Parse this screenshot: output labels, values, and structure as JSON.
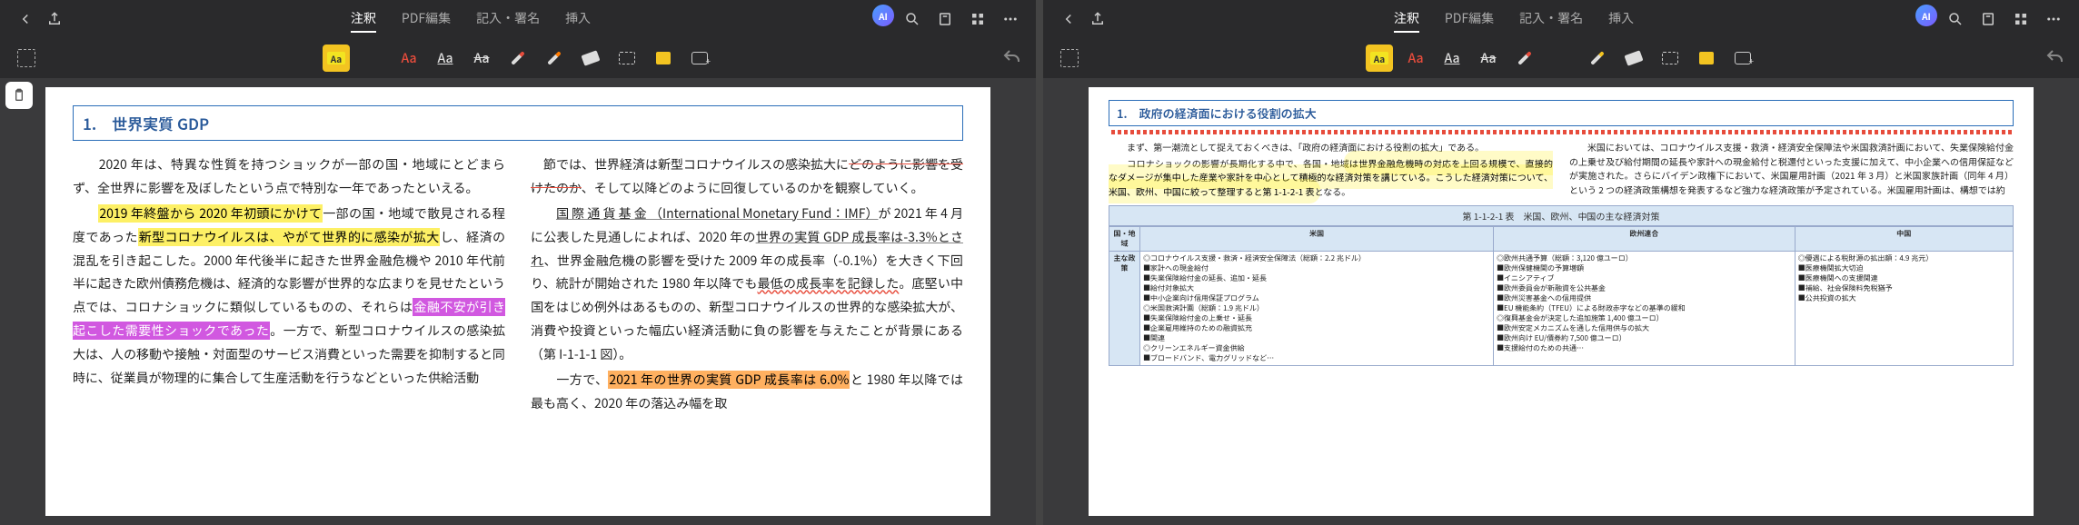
{
  "tabs": {
    "annotate": "注釈",
    "pdf_edit": "PDF編集",
    "fill_sign": "記入・署名",
    "insert": "挿入"
  },
  "ai_badge": "AI",
  "tool_labels": {
    "aa": "Aa"
  },
  "left": {
    "heading": "1.　世界実質 GDP",
    "c1p1": "　2020 年は、特異な性質を持つショックが一部の国・地域にとどまらず、全世界に影響を及ぼしたという点で特別な一年であったといえる。",
    "c1p2a": "2019 年終盤から 2020 年初頭にかけて",
    "c1p2b": "一部の国・地域で散見される程度であった",
    "c1p2c": "新型コロナウイルスは、やがて世界的に感染が拡大",
    "c1p2d": "し、経済の混乱を引き起こした。2000 年代後半に起きた世界金融危機や 2010 年代前半に起きた欧州債務危機は、経済的な影響が世界的な広まりを見せたという点では、コロナショックに類似しているものの、それらは",
    "c1p2e": "金融不安が引き起こした需要性ショックであった",
    "c1p2f": "。一方で、新型コロナウイルスの感染拡大は、人の移動や接触・対面型のサービス消費といった需要を抑制すると同時に、従業員が物理的に集合して生産活動を行うなどといった供給活動",
    "c2p1a": "節では、世界経済は新型コロナウイルスの感染拡大に",
    "c2p1b": "どのように影響を受けたのか",
    "c2p1c": "、そして以降どのように回復しているのかを観察していく。",
    "c2p2a": "国 際 通 貨 基 金 （International Monetary Fund：IMF）",
    "c2p2b": "が 2021 年 4 月に公表した見通しによれば、2020 年の",
    "c2p2c": "世界の実質 GDP 成長率は-3.3%とされ",
    "c2p2d": "、世界金融危機の影響を受けた 2009 年の成長率（-0.1%）を大きく下回り、統計が開始された 1980 年以降でも",
    "c2p2e": "最低の成長率を記録した",
    "c2p2f": "。底堅い中国をはじめ例外はあるものの、新型コロナウイルスの世界的な感染拡大が、消費や投資といった幅広い経済活動に負の影響を与えたことが背景にある（第 I-1-1-1 図）。",
    "c2p3a": "　一方で、",
    "c2p3b": "2021 年の世界の実質 GDP 成長率は 6.0%",
    "c2p3c": "と 1980 年以降では最も高く、2020 年の落込み幅を取"
  },
  "right": {
    "heading": "1.　政府の経済面における役割の拡大",
    "c1p1": "　まず、第一潮流として捉えておくべきは、「政府の経済面における役割の拡大」である。",
    "c1p2a": "　コロナショックの影響が長期化する中で、各国・地域",
    "c1p2y": "は世界金融危機時の対応を上回る規模で、直接的なダメージが集中した産業や家計を中心として積極的な経済対策を講じている。こうした経済対策について、米国、欧州、中国に絞って整理すると第 1-1-2-1 表",
    "c1p2b": "となる。",
    "c2p1": "　米国においては、コロナウイルス支援・救済・経済安全保障法や米国救済計画において、失業保険給付金の上乗せ及び給付期間の延長や家計への現金給付と税還付といった支援に加えて、中小企業への信用保証などが実施された。さらにバイデン政権下において、米国雇用計画（2021 年 3 月）と米国家族計画（同年 4 月）という 2 つの経済政策構想を発表するなど強力な経済政策が予定されている。米国雇用計画は、構想では約",
    "table_title": "第 1-1-2-1 表　米国、欧州、中国の主な経済対策",
    "th_region": "国・地域",
    "th_us": "米国",
    "th_eu": "欧州連合",
    "th_cn": "中国",
    "row1": "主な政策",
    "us_cells": [
      "◎コロナウイルス支援・救済・経済安全保障法（総額：2.2 兆ドル）",
      "■家計への現金給付",
      "■失業保険給付金の延長、追加・延長",
      "■給付対象拡大",
      "■中小企業向け信用保証プログラム",
      "◎米国救済計画（総額：1.9 兆ドル）",
      "■失業保険給付金の上乗せ・延長",
      "■企業雇用維持のための融資拡充",
      "■関連",
      "◎クリーンエネルギー資金供給",
      "■ブロードバンド、電力グリッドなど…"
    ],
    "eu_cells": [
      "◎欧州共通予算（総額：3,120 億ユーロ）",
      "■欧州保健機関の予算増額",
      "■イニシアティブ",
      "■欧州委員会が新融資を公共基金",
      "■欧州災害基金への信用提供",
      "■EU 機能条約（TFEU）による財政赤字などの基準の緩和",
      "◎復興基金会が決定した追加施策 1,400 億ユーロ）",
      "■欧州安定メカニズムを通した信用供与の拡大",
      "■欧州向け EU/債券約 7,500 億ユーロ）",
      "■支援給付のための共通…"
    ],
    "cn_cells": [
      "◎優遇による税財源の拡出額：4.9 兆元）",
      "■医療機関拡大切迫",
      "■医療機関への支援関連",
      "■補給、社会保険料免税猶予",
      "■公共投資の拡大"
    ]
  }
}
